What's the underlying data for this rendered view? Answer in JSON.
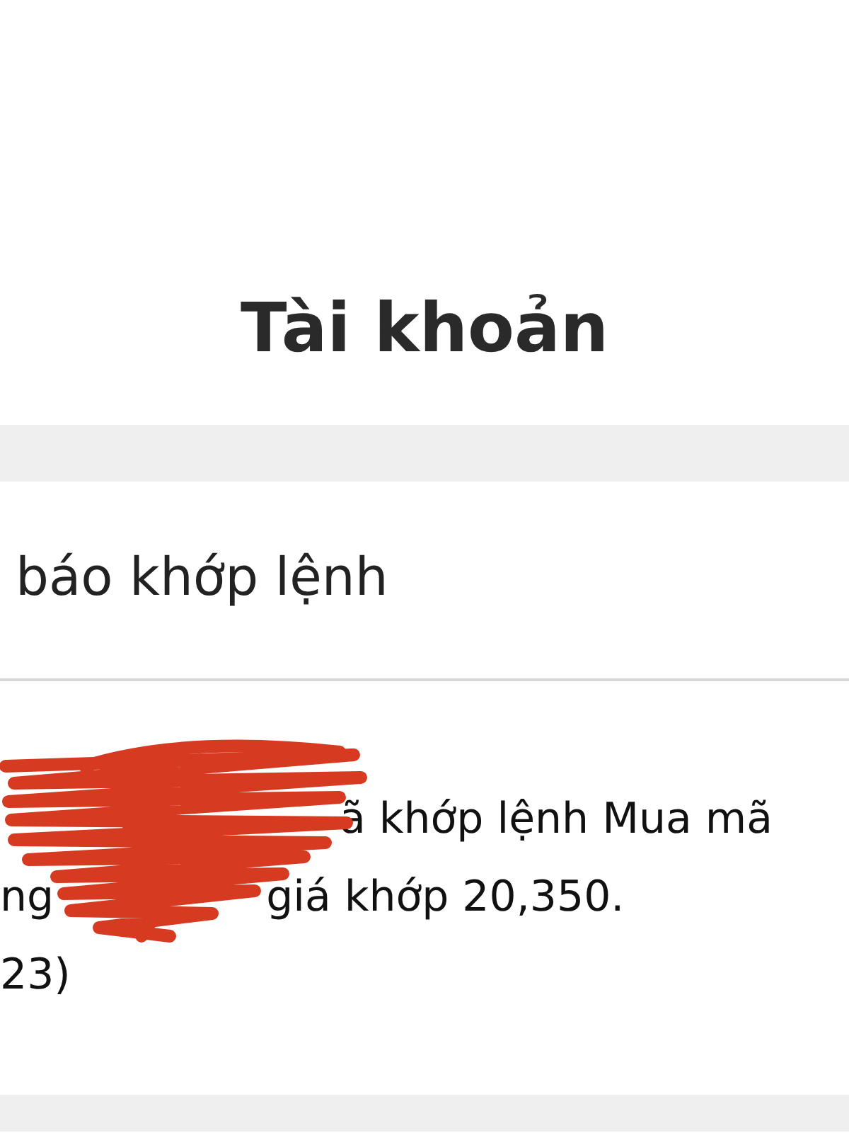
{
  "header": {
    "title": "Tài khoản"
  },
  "section": {
    "title": "báo khớp lệnh"
  },
  "message": {
    "lines": [
      [
        "ã khớp lệnh Mua mã"
      ],
      [
        "ng",
        "giá khớp 20,350."
      ],
      [
        "23)"
      ]
    ]
  }
}
